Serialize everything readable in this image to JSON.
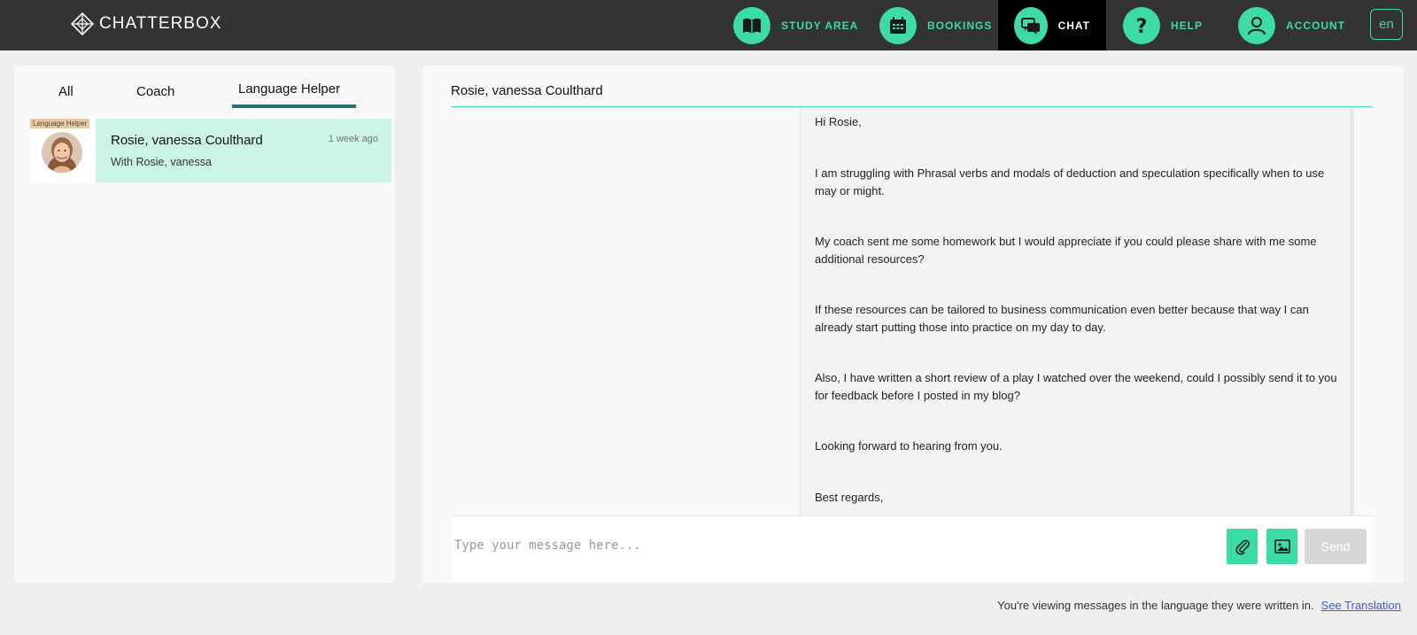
{
  "brand": {
    "name": "CHATTERBOX"
  },
  "nav": {
    "items": [
      {
        "label": "STUDY AREA",
        "icon": "book-icon"
      },
      {
        "label": "BOOKINGS",
        "icon": "calendar-icon"
      },
      {
        "label": "CHAT",
        "icon": "chat-icon",
        "active": true
      },
      {
        "label": "HELP",
        "icon": "question-icon"
      },
      {
        "label": "ACCOUNT",
        "icon": "user-icon"
      }
    ],
    "language": "en"
  },
  "tabs": [
    {
      "label": "All"
    },
    {
      "label": "Coach"
    },
    {
      "label": "Language Helper",
      "active": true
    }
  ],
  "conversations": [
    {
      "tag": "Language Helper",
      "name": "Rosie, vanessa Coulthard",
      "subtitle": "With Rosie, vanessa",
      "time": "1 week ago"
    }
  ],
  "chat": {
    "header": "Rosie, vanessa Coulthard",
    "message": [
      "Hi Rosie,",
      "I am struggling with Phrasal verbs and modals of deduction and speculation specifically when to use may or might.",
      "My coach sent me some homework but I would appreciate if you could please share with me some additional resources?",
      "If these resources can be tailored to business communication even better because that way I can already start putting those into practice on my day to day.",
      "Also, I have written a short review of a play I watched over the weekend, could I possibly send it to you for feedback before I posted in my blog?",
      "Looking forward to hearing from you.",
      "Best regards,"
    ],
    "composer": {
      "placeholder": "Type your message here...",
      "send_label": "Send"
    }
  },
  "footer": {
    "note": "You're viewing messages in the language they were written in.",
    "link": "See Translation"
  },
  "colors": {
    "accent": "#3ddba5",
    "topbar": "#333333",
    "selected_row": "#ccf4e6",
    "tab_underline": "#2c6e79",
    "link": "#3b5bd9"
  }
}
